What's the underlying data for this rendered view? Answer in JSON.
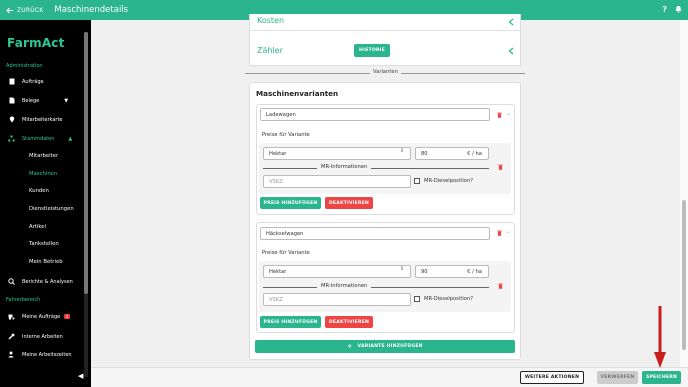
{
  "topbar": {
    "back_label": "ZURÜCK",
    "title": "Maschinendetails",
    "help": "?"
  },
  "sidebar": {
    "logo": "FarmAct",
    "section_admin": "Administration",
    "items": {
      "auftraege": "Aufträge",
      "belege": "Belege",
      "mitarbeiterkarte": "Mitarbeiterkarte",
      "stammdaten": "Stammdaten",
      "berichte": "Berichte & Analysen"
    },
    "subitems": {
      "mitarbeiter": "Mitarbeiter",
      "maschinen": "Maschinen",
      "kunden": "Kunden",
      "dienstleistungen": "Dienstleistungen",
      "artikel": "Artikel",
      "tankstellen": "Tankstellen",
      "mein_betrieb": "Mein Betrieb"
    },
    "section_fahrer": "Fahrerbereich",
    "fahrer_items": {
      "meine_auftraege": "Meine Aufträge",
      "meine_auftraege_badge": "1",
      "interne_arbeiten": "Interne Arbeiten",
      "meine_arbeitszeiten": "Meine Arbeitszeiten"
    }
  },
  "main": {
    "kosten_label": "Kosten",
    "zaehler_label": "Zähler",
    "historie_button": "HISTORIE",
    "varianten_divider": "Varianten",
    "maschinenvarianten_title": "Maschinenvarianten",
    "variants": [
      {
        "name": "Ladewagen",
        "preise_label": "Preise für Variante",
        "unit_select": "Hektar",
        "price": "80",
        "price_unit": "€ / ha",
        "mr_label": "MR-Informationen",
        "vskz_placeholder": "VSKZ",
        "diesel_label": "MR-Dieselposition?",
        "add_price": "PREIS HINZUFÜGEN",
        "deactivate": "DEAKTIVIEREN"
      },
      {
        "name": "Häckselwagen",
        "preise_label": "Preise für Variante",
        "unit_select": "Hektar",
        "price": "90",
        "price_unit": "€ / ha",
        "mr_label": "MR-Informationen",
        "vskz_placeholder": "VSKZ",
        "diesel_label": "MR-Dieselposition?",
        "add_price": "PREIS HINZUFÜGEN",
        "deactivate": "DEAKTIVIEREN"
      }
    ],
    "add_variant": "VARIANTE HINZUFÜGEN"
  },
  "footer": {
    "weitere_aktionen": "WEITERE AKTIONEN",
    "verwerfen": "VERWERFEN",
    "speichern": "SPEICHERN"
  },
  "colors": {
    "accent": "#2bb58e",
    "danger": "#ef4444",
    "annotation_arrow": "#c81e1e"
  }
}
